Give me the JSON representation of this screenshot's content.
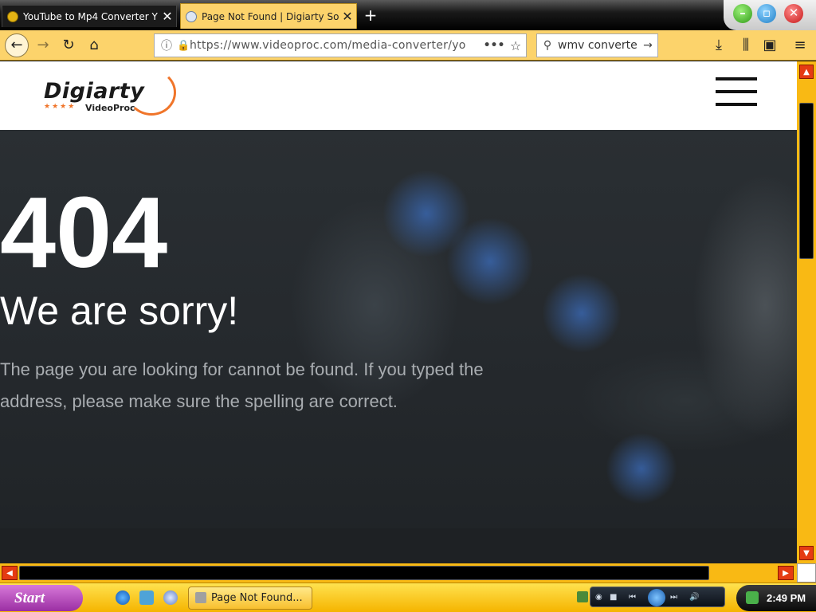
{
  "browser": {
    "tabs": [
      {
        "title": "YouTube to Mp4 Converter Y",
        "active": false
      },
      {
        "title": "Page Not Found | Digiarty So",
        "active": true
      }
    ],
    "url": "https://www.videoproc.com/media-converter/yo",
    "search_query": "wmv converter"
  },
  "site": {
    "logo_brand": "Digiarty",
    "logo_sub": "VideoProc",
    "logo_stars": "★★★★"
  },
  "error": {
    "code": "404",
    "title": "We are sorry!",
    "message": "The page you are looking for cannot be found. If you typed the address, please make sure the spelling are correct."
  },
  "taskbar": {
    "start_label": "Start",
    "task_label": "Page Not Found...",
    "clock": "2:49 PM"
  },
  "colors": {
    "accent": "#f0752a",
    "toolbar": "#fcd36b",
    "scrollbar": "#f9b914",
    "hero": "#23272b"
  }
}
